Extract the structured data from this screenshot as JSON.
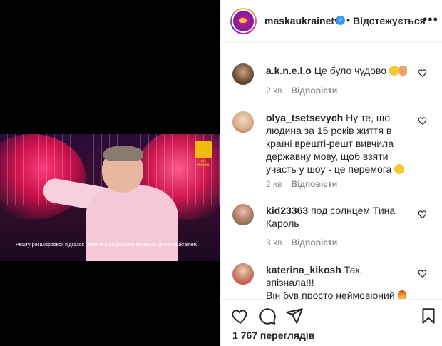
{
  "post": {
    "caption_overlay": "Решту розшифровок підказок читайте в соціальних мережах @maskaukrainetv",
    "channel_logo": "ТРК УКРАЇНА"
  },
  "header": {
    "username": "maskaukrainetv",
    "verified_icon": "verified-badge-icon",
    "separator": "•",
    "follow_status": "Відстежується",
    "more_icon": "more-options-icon"
  },
  "comments": [
    {
      "username": "a.k.n.e.l.o",
      "text": "Це було чудово",
      "emojis": [
        "smile-emoji",
        "victory-hand-emoji"
      ],
      "time": "2 хв",
      "reply_label": "Відповісти"
    },
    {
      "username": "olya_tsetsevych",
      "text_line1": "Ну те, що",
      "text_line2": "людина за 15 років життя в",
      "text_line3": "країні врешті-решт вивчила",
      "text_line4": "державну мову, щоб взяти",
      "text_line5": "участь у шоу - це перемога",
      "emojis": [
        "laughing-emoji"
      ],
      "time": "2 хв",
      "reply_label": "Відповісти"
    },
    {
      "username": "kid23363",
      "text_line1": "под солнцем Тина",
      "text_line2": "Кароль",
      "time": "3 хв",
      "reply_label": "Відповісти"
    },
    {
      "username": "katerina_kikosh",
      "text_line1": "Так, впізнала!!!",
      "text_line2": "Він був просто неймовірний",
      "emojis": [
        "fire-emoji",
        "fire-emoji",
        "fire-emoji"
      ]
    }
  ],
  "footer": {
    "views": "1 767 переглядів",
    "icons": [
      "heart-icon",
      "comment-icon",
      "share-icon",
      "bookmark-icon"
    ]
  },
  "colors": {
    "verified": "#3897f0",
    "meta_gray": "#8e8e8e",
    "text": "#262626",
    "border": "#efefef"
  }
}
